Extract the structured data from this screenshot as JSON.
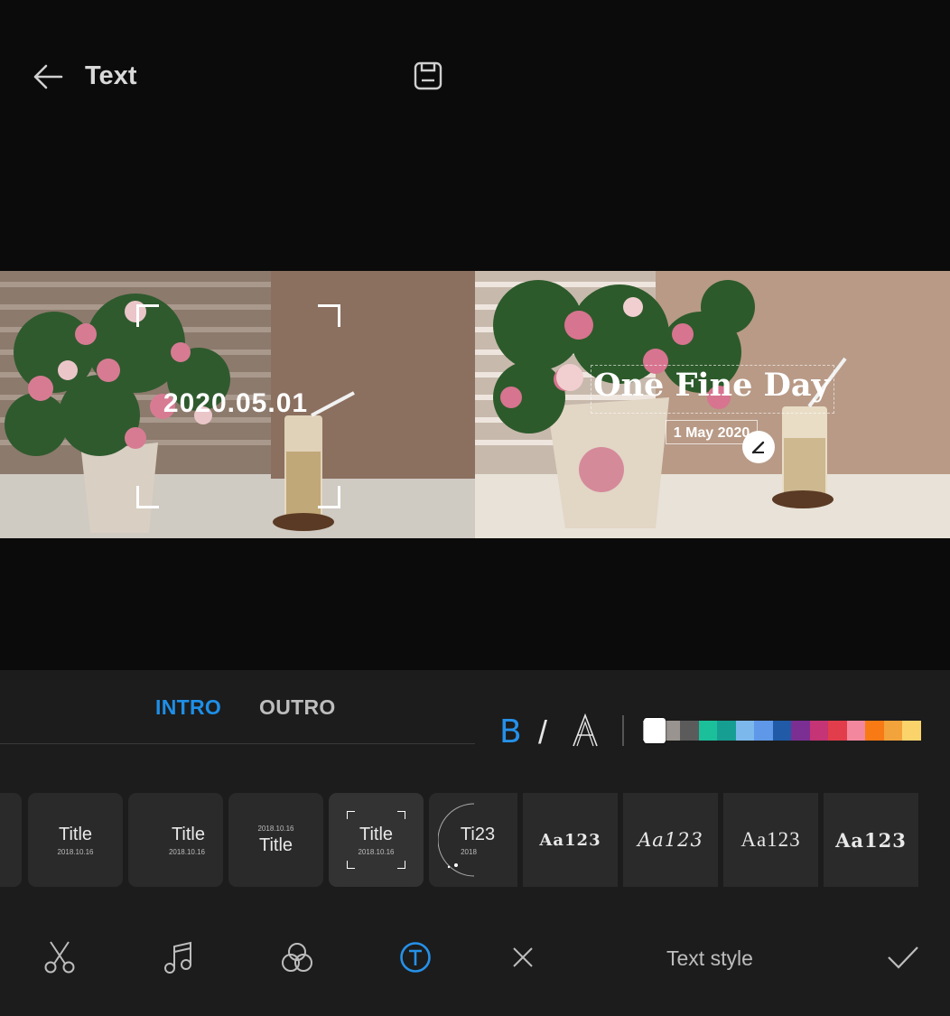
{
  "header": {
    "title": "Text",
    "back_icon": "arrow-left-icon",
    "save_icon": "save-icon"
  },
  "previews": {
    "left": {
      "caption": "2020.05.01"
    },
    "right": {
      "title": "One Fine Day",
      "subtitle": "1 May 2020",
      "edit_icon": "edit-pen-icon"
    }
  },
  "tabs": [
    {
      "label": "INTRO",
      "active": true
    },
    {
      "label": "OUTRO",
      "active": false
    }
  ],
  "format": {
    "bold_label": "B",
    "italic_label": "/",
    "outline_label": "A"
  },
  "palette": [
    "#ffffff",
    "#9a9490",
    "#5b5b5b",
    "#1bbf9a",
    "#169e92",
    "#7db8ec",
    "#5f98e8",
    "#215aa6",
    "#7b2f93",
    "#c53474",
    "#e23d4b",
    "#f2879e",
    "#f77a14",
    "#f2a33b",
    "#fbd36b"
  ],
  "templates": [
    {
      "title": "Title",
      "date": "2018.10.16"
    },
    {
      "title": "Title",
      "date": "2018.10.16"
    },
    {
      "title": "Title",
      "date": "2018.10.16"
    },
    {
      "title": "Title",
      "date": "2018.10.16",
      "selected": true
    },
    {
      "title": "Ti23",
      "date": "2018"
    }
  ],
  "fonts": [
    "Aa123",
    "Aa123",
    "Aa123",
    "Aa123"
  ],
  "bottom_nav": {
    "icons": [
      "scissors-icon",
      "music-note-icon",
      "filter-circles-icon",
      "text-icon"
    ],
    "close_icon": "close-icon",
    "label": "Text style",
    "confirm_icon": "check-icon"
  }
}
